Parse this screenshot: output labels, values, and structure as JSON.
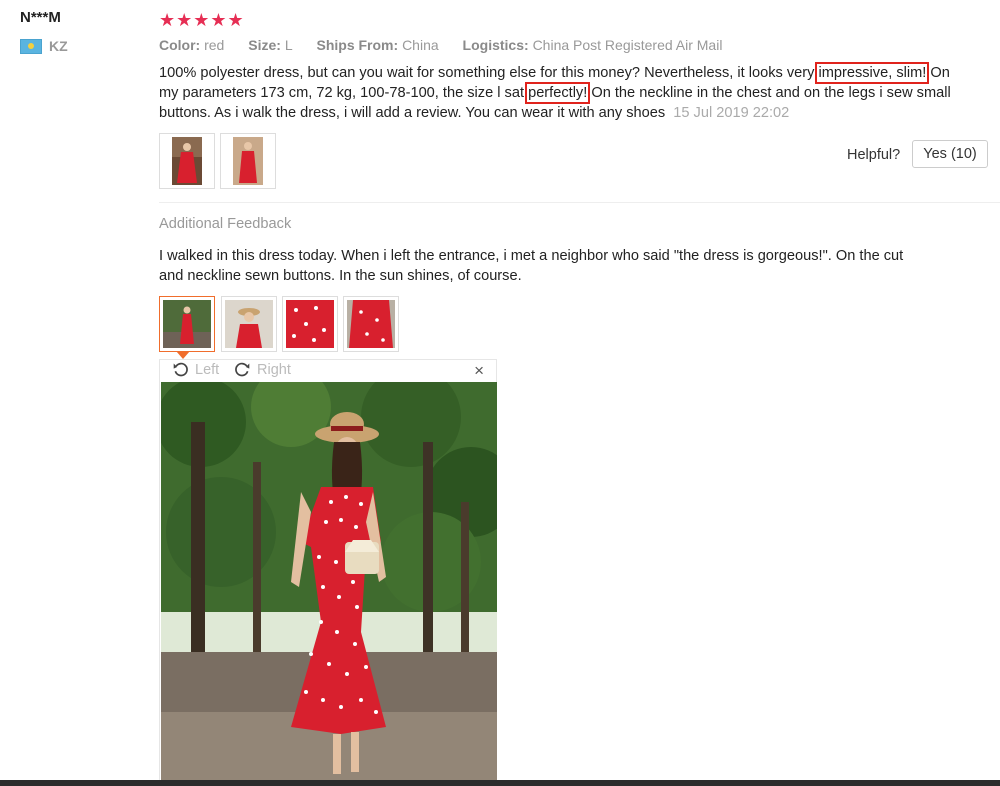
{
  "reviewer": {
    "name": "N***M",
    "country": "KZ"
  },
  "rating": {
    "stars": 5,
    "display": "★★★★★"
  },
  "attributes": [
    {
      "label": "Color:",
      "value": "red"
    },
    {
      "label": "Size:",
      "value": "L"
    },
    {
      "label": "Ships From:",
      "value": "China"
    },
    {
      "label": "Logistics:",
      "value": "China Post Registered Air Mail"
    }
  ],
  "review": {
    "part1": "100% polyester dress, but can you wait for something else for this money? Nevertheless, it looks very ",
    "highlight1": "impressive, slim!",
    "part2": " On my parameters 173 cm, 72 kg, 100-78-100, the size l sat ",
    "highlight2": "perfectly!",
    "part3": " On the neckline in the chest and on the legs i sew small buttons. As i walk the dress, i will add a review. You can wear it with any shoes",
    "date": "15 Jul 2019 22:02"
  },
  "helpful": {
    "label": "Helpful?",
    "yes_label": "Yes (10)"
  },
  "additional": {
    "title": "Additional Feedback",
    "text": "I walked in this dress today. When i left the entrance, i met a neighbor who said \"the dress is gorgeous!\". On the cut and neckline sewn buttons. In the sun shines, of course."
  },
  "viewer": {
    "rotate_left": "Left",
    "rotate_right": "Right",
    "close": "×"
  },
  "colors": {
    "star": "#e62e54",
    "highlight_box": "#e0231c",
    "selected_thumb": "#f06d2c",
    "dress": "#d8202e"
  }
}
